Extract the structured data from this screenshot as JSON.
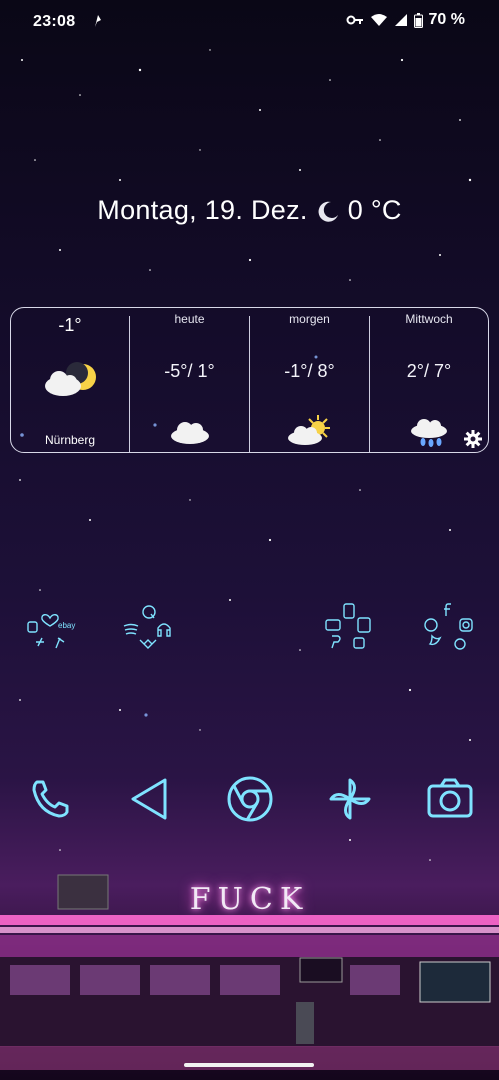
{
  "status_bar": {
    "time": "23:08",
    "battery_percent": "70 %"
  },
  "date_weather": {
    "date": "Montag, 19. Dez.",
    "temperature": "0 °C",
    "icon": "crescent-moon-icon"
  },
  "weather_widget": {
    "current": {
      "temperature": "-1°",
      "city": "Nürnberg",
      "icon": "cloud-moon-icon"
    },
    "forecast": [
      {
        "day": "heute",
        "temps": "-5°/ 1°",
        "icon": "cloud-icon"
      },
      {
        "day": "morgen",
        "temps": "-1°/ 8°",
        "icon": "sun-cloud-icon"
      },
      {
        "day": "Mittwoch",
        "temps": "2°/ 7°",
        "icon": "rain-cloud-icon"
      }
    ]
  },
  "folders": [
    {
      "name": "folder-shopping",
      "icons": [
        "heart-icon",
        "ebay-icon",
        "watch-icon",
        "cactus-icon",
        "tools-icon"
      ]
    },
    {
      "name": "folder-music",
      "icons": [
        "quora-icon",
        "spotify-icon",
        "headphones-icon",
        "tidal-icon"
      ]
    },
    {
      "name": "folder-finance",
      "icons": [
        "card-icon",
        "bank-icon",
        "phone-icon",
        "paypal-icon",
        "lock-icon"
      ]
    },
    {
      "name": "folder-social",
      "icons": [
        "facebook-icon",
        "whatsapp-icon",
        "instagram-icon",
        "twitter-icon",
        "messenger-icon"
      ]
    }
  ],
  "dock": [
    "phone-icon",
    "back-arrow-icon",
    "chrome-icon",
    "pinwheel-icon",
    "camera-icon"
  ],
  "wallpaper": {
    "sign_text": "FUCK",
    "accent": "#7fe3ff"
  }
}
